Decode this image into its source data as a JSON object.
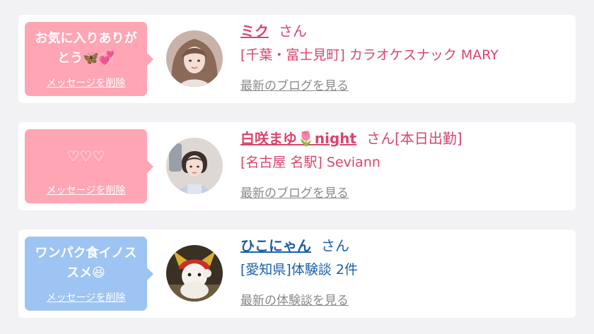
{
  "messages": [
    {
      "bubble_color": "#ffa5b4",
      "bubble_line1": "お気に入りありが",
      "bubble_line2": "とう🦋💞",
      "delete_label": "メッセージを削除",
      "name": "ミク",
      "suffix": "さん",
      "shop": "[千葉・富士見町] カラオケスナック MARY",
      "link": "最新のブログを見る",
      "text_color": "#d9456d"
    },
    {
      "bubble_color": "#ffa5b4",
      "bubble_line1": "♡♡♡",
      "bubble_line2": "",
      "delete_label": "メッセージを削除",
      "name": "白咲まゆ🌷night",
      "suffix": "さん[本日出勤]",
      "shop": "[名古屋 名駅] Seviann",
      "link": "最新のブログを見る",
      "text_color": "#d9456d"
    },
    {
      "bubble_color": "#9dc4f2",
      "bubble_line1": "ワンパク食イノス",
      "bubble_line2": "スメ😆",
      "delete_label": "メッセージを削除",
      "name": "ひこにゃん",
      "suffix": "さん",
      "shop": "[愛知県]体験談 2件",
      "link": "最新の体験談を見る",
      "text_color": "#1b5fa8"
    }
  ]
}
